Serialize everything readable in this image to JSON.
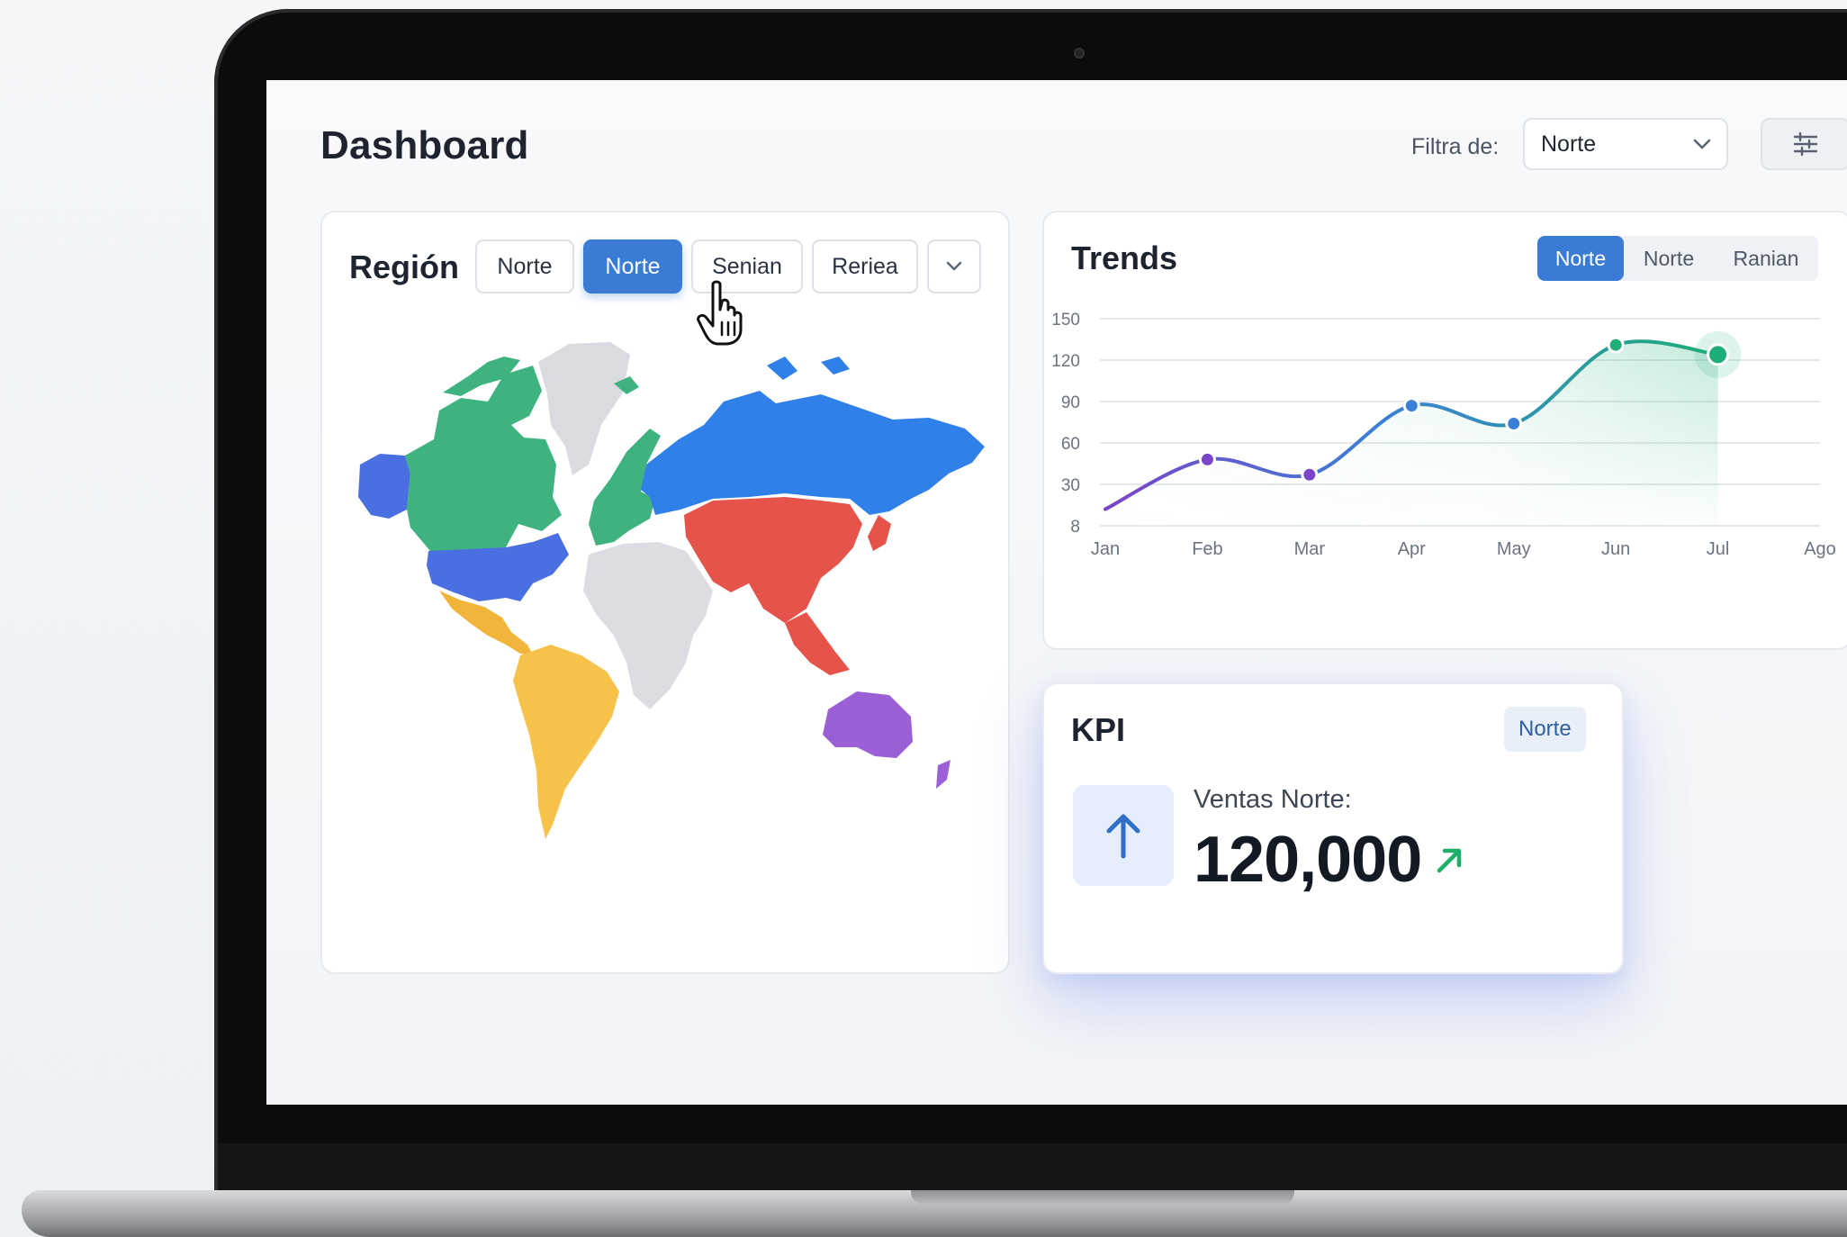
{
  "header": {
    "title": "Dashboard",
    "filter_label": "Filtra de:",
    "filter_value": "Norte"
  },
  "region": {
    "title": "Región",
    "options": [
      "Norte",
      "Norte",
      "Senian",
      "Reriea"
    ],
    "active_index": 1,
    "map_colors": {
      "north_america_north": "#3fb37f",
      "alaska": "#4a6fe0",
      "usa": "#4a6fe0",
      "central_america": "#f2b53b",
      "south_america": "#f6c24a",
      "europe": "#3fb37f",
      "russia": "#2f80e8",
      "asia_south_east": "#e5534b",
      "africa": "#dcdde2",
      "greenland": "#d9dbe0",
      "oceania": "#9b5fd6"
    }
  },
  "trends": {
    "title": "Trends",
    "tabs": [
      "Norte",
      "Norte",
      "Ranian"
    ],
    "active_tab": 0
  },
  "chart_data": {
    "type": "line",
    "title": "Trends",
    "categories": [
      "Jan",
      "Feb",
      "Mar",
      "Apr",
      "May",
      "Jun",
      "Jul",
      "Ago"
    ],
    "y_ticks": [
      "8",
      "30",
      "60",
      "90",
      "120",
      "150"
    ],
    "series": [
      {
        "values": [
          12,
          48,
          37,
          87,
          74,
          131,
          124
        ]
      }
    ],
    "ylim": [
      0,
      150
    ],
    "grid": true,
    "colors": {
      "start": "#7b45c9",
      "mid": "#3b7fd6",
      "end": "#1fae78"
    }
  },
  "kpi": {
    "title": "KPI",
    "badge": "Norte",
    "label": "Ventas Norte:",
    "value": "120,000",
    "trend_icon": "arrow-up-right-icon",
    "main_icon": "arrow-up-icon"
  }
}
